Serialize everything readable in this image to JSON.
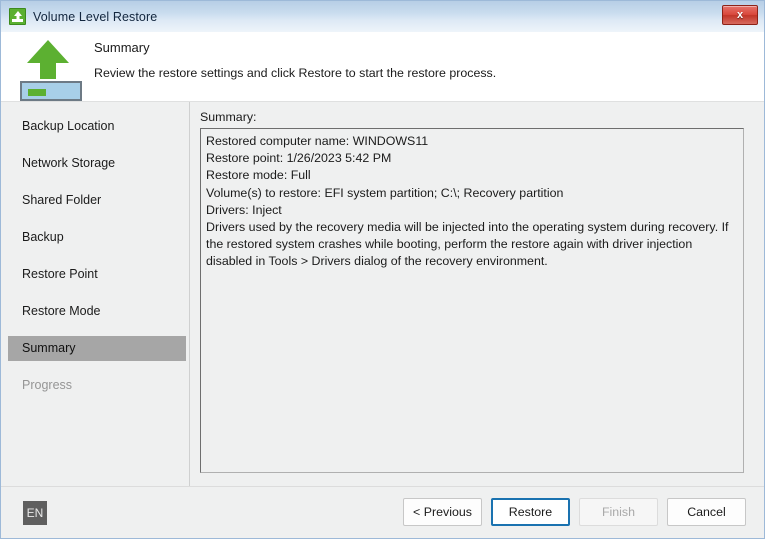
{
  "window": {
    "title": "Volume Level Restore",
    "title_icon": "restore-volume-icon",
    "close_label": "x"
  },
  "header": {
    "icon": "green-up-arrow-drive-icon",
    "title": "Summary",
    "subtitle": "Review the restore settings and click Restore to start the restore process."
  },
  "sidebar": {
    "items": [
      {
        "label": "Backup Location",
        "state": "normal"
      },
      {
        "label": "Network Storage",
        "state": "normal"
      },
      {
        "label": "Shared Folder",
        "state": "normal"
      },
      {
        "label": "Backup",
        "state": "normal"
      },
      {
        "label": "Restore Point",
        "state": "normal"
      },
      {
        "label": "Restore Mode",
        "state": "normal"
      },
      {
        "label": "Summary",
        "state": "active"
      },
      {
        "label": "Progress",
        "state": "disabled"
      }
    ]
  },
  "content": {
    "summary_label": "Summary:",
    "summary_lines": [
      "Restored computer name: WINDOWS11",
      "Restore point: 1/26/2023 5:42 PM",
      "Restore mode: Full",
      "Volume(s) to restore: EFI system partition; C:\\; Recovery partition",
      "Drivers: Inject"
    ],
    "summary_note": "Drivers used by the recovery media will be injected into the operating system during recovery. If the restored system crashes while booting, perform the restore again with driver injection disabled in Tools > Drivers dialog of the recovery environment."
  },
  "footer": {
    "language": "EN",
    "buttons": [
      {
        "label": "< Previous",
        "state": "normal"
      },
      {
        "label": "Restore",
        "state": "default"
      },
      {
        "label": "Finish",
        "state": "disabled"
      },
      {
        "label": "Cancel",
        "state": "normal"
      }
    ]
  },
  "colors": {
    "accent_green": "#5cb031",
    "focus_blue": "#1a72b0",
    "close_red": "#d9483c",
    "sidebar_active": "#a6a6a6"
  }
}
